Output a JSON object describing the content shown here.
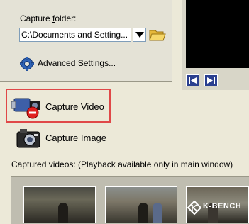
{
  "settings": {
    "capture_folder_label_pre": "Capture ",
    "capture_folder_label_u": "f",
    "capture_folder_label_post": "older:",
    "folder_value": "C:\\Documents and Setting...",
    "advanced_pre": "",
    "advanced_u": "A",
    "advanced_post": "dvanced Settings..."
  },
  "actions": {
    "capture_video_pre": "Capture ",
    "capture_video_u": "V",
    "capture_video_post": "ideo",
    "capture_image_pre": "Capture ",
    "capture_image_u": "I",
    "capture_image_post": "mage"
  },
  "captured": {
    "label": "Captured videos: (Playback available only in main window)"
  },
  "watermark": {
    "text": "K-BENCH"
  },
  "colors": {
    "highlight": "#e04848",
    "nav_button": "#2a3f8f"
  },
  "icons": {
    "folder": "folder-open-icon",
    "gear": "gear-icon",
    "video": "video-camera-icon",
    "image": "photo-camera-icon",
    "nav_left": "step-back-icon",
    "nav_right": "step-forward-icon"
  }
}
